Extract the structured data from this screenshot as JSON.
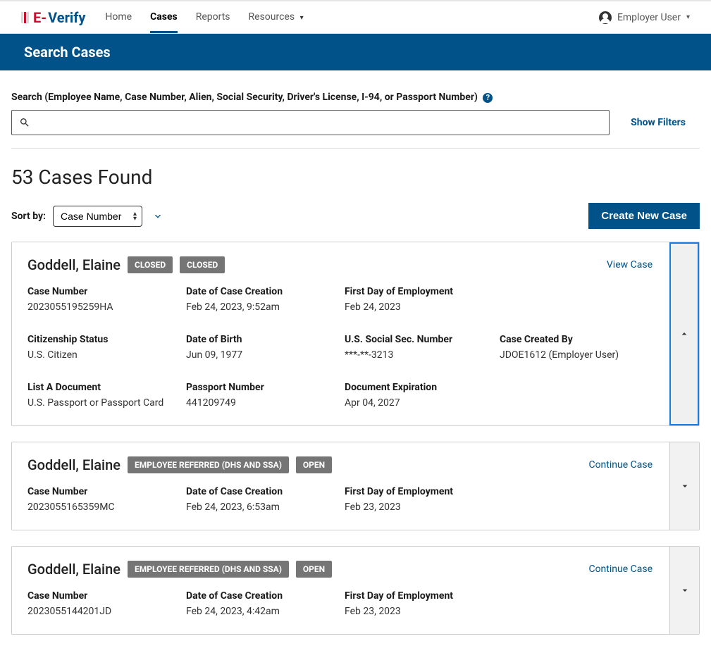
{
  "nav": {
    "home": "Home",
    "cases": "Cases",
    "reports": "Reports",
    "resources": "Resources",
    "user_label": "Employer User"
  },
  "titlebar": "Search Cases",
  "search": {
    "label": "Search (Employee Name, Case Number, Alien, Social Security, Driver's License, I-94, or Passport Number)",
    "value": "",
    "show_filters": "Show Filters"
  },
  "results_count": "53 Cases Found",
  "sort": {
    "label": "Sort by:",
    "selected": "Case Number"
  },
  "create_case_btn": "Create New Case",
  "cards": [
    {
      "name": "Goddell, Elaine",
      "badges": [
        "CLOSED",
        "CLOSED"
      ],
      "action": "View Case",
      "expanded": true,
      "fields": {
        "case_number_label": "Case Number",
        "case_number": "2023055195259HA",
        "created_label": "Date of Case Creation",
        "created": "Feb 24, 2023, 9:52am",
        "first_day_label": "First Day of Employment",
        "first_day": "Feb 24, 2023",
        "cit_label": "Citizenship Status",
        "cit": "U.S. Citizen",
        "dob_label": "Date of Birth",
        "dob": "Jun 09, 1977",
        "ssn_label": "U.S. Social Sec. Number",
        "ssn": "***-**-3213",
        "created_by_label": "Case Created By",
        "created_by": "JDOE1612 (Employer User)",
        "lista_label": "List A Document",
        "lista": "U.S. Passport or Passport Card",
        "passport_label": "Passport Number",
        "passport": "441209749",
        "docexp_label": "Document Expiration",
        "docexp": "Apr 04, 2027"
      }
    },
    {
      "name": "Goddell, Elaine",
      "badges": [
        "EMPLOYEE REFERRED (DHS AND SSA)",
        "OPEN"
      ],
      "action": "Continue Case",
      "expanded": false,
      "fields": {
        "case_number_label": "Case Number",
        "case_number": "2023055165359MC",
        "created_label": "Date of Case Creation",
        "created": "Feb 24, 2023, 6:53am",
        "first_day_label": "First Day of Employment",
        "first_day": "Feb 23, 2023"
      }
    },
    {
      "name": "Goddell, Elaine",
      "badges": [
        "EMPLOYEE REFERRED (DHS AND SSA)",
        "OPEN"
      ],
      "action": "Continue Case",
      "expanded": false,
      "fields": {
        "case_number_label": "Case Number",
        "case_number": "2023055144201JD",
        "created_label": "Date of Case Creation",
        "created": "Feb 24, 2023, 4:42am",
        "first_day_label": "First Day of Employment",
        "first_day": "Feb 23, 2023"
      }
    }
  ]
}
